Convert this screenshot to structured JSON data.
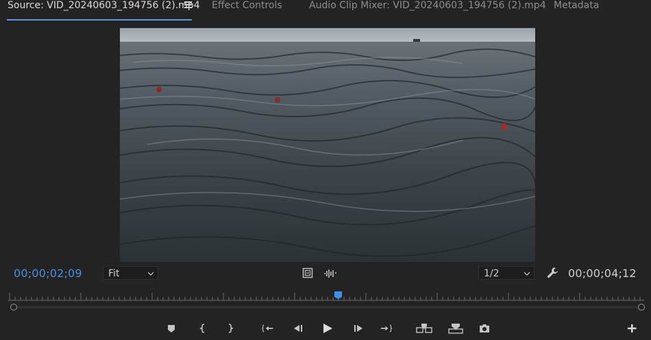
{
  "tabs": [
    {
      "label": "Source: VID_20240603_194756 (2).mp4"
    },
    {
      "label": "Effect Controls"
    },
    {
      "label": "Audio Clip Mixer: VID_20240603_194756 (2).mp4"
    },
    {
      "label": "Metadata"
    }
  ],
  "monitor": {
    "current_timecode": "00;00;02;09",
    "duration_timecode": "00;00;04;12",
    "zoom": "Fit",
    "resolution": "1/2",
    "playhead_fraction": 0.52
  },
  "colors": {
    "accent": "#4a90e2",
    "background": "#232323"
  },
  "icons": {
    "panel_menu": "hamburger-menu-icon",
    "safe_margins": "safe-margins-icon",
    "audio_waveform": "waveform-icon",
    "settings": "wrench-icon"
  },
  "transport": [
    "add-marker-icon",
    "mark-in-icon",
    "mark-out-icon",
    "go-to-in-icon",
    "step-back-icon",
    "play-icon",
    "step-forward-icon",
    "go-to-out-icon",
    "insert-icon",
    "overwrite-icon",
    "export-frame-icon",
    "add-button-icon"
  ]
}
